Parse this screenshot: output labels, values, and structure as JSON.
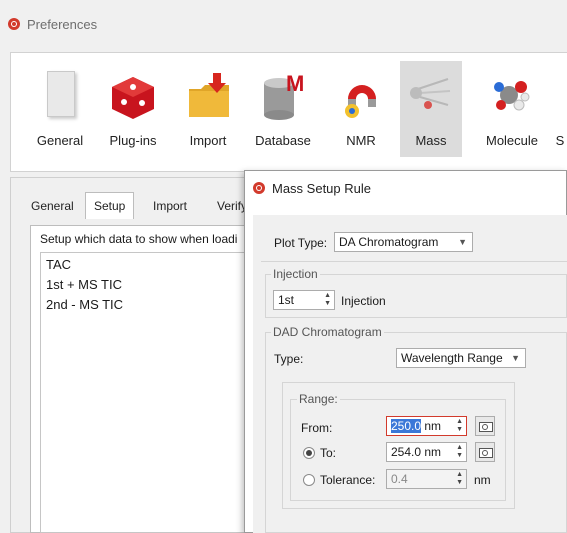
{
  "preferences": {
    "title": "Preferences",
    "toolbar": [
      {
        "label": "General",
        "icon": "general-icon"
      },
      {
        "label": "Plug-ins",
        "icon": "plugins-icon"
      },
      {
        "label": "Import",
        "icon": "import-folder-icon"
      },
      {
        "label": "Database",
        "icon": "database-icon"
      },
      {
        "label": "NMR",
        "icon": "nmr-icon"
      },
      {
        "label": "Mass",
        "icon": "mass-icon",
        "active": true
      },
      {
        "label": "Molecule",
        "icon": "molecule-icon"
      },
      {
        "label": "S",
        "icon": "partial-icon"
      }
    ],
    "tabs": [
      "General",
      "Setup",
      "Import",
      "Verify"
    ],
    "active_tab": "Setup",
    "setup_caption": "Setup which data to show when loadi",
    "setup_items": [
      "TAC",
      "1st + MS TIC",
      "2nd - MS TIC"
    ]
  },
  "dialog": {
    "title": "Mass Setup Rule",
    "plot_type_label": "Plot Type:",
    "plot_type_value": "DA Chromatogram",
    "injection_group": "Injection",
    "injection_value": "1st",
    "injection_label": "Injection",
    "dad_group": "DAD Chromatogram",
    "type_label": "Type:",
    "type_value": "Wavelength Range",
    "range_group": "Range:",
    "from_label": "From:",
    "from_value": "250.0",
    "from_unit": "nm",
    "to_label": "To:",
    "to_value": "254.0 nm",
    "tolerance_label": "Tolerance:",
    "tolerance_value": "0.4",
    "tolerance_unit": "nm"
  },
  "colors": {
    "accent": "#d23a2c",
    "selection": "#3b78d8"
  }
}
